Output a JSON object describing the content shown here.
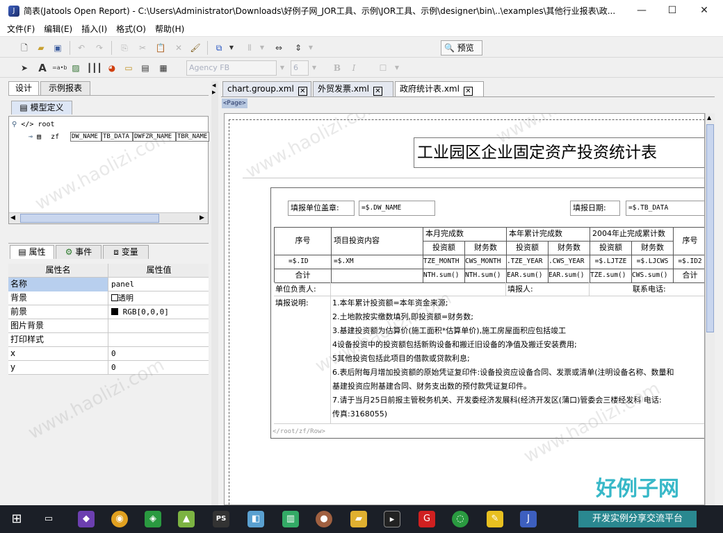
{
  "window": {
    "title": "简表(Jatools Open Report) - C:\\Users\\Administrator\\Downloads\\好例子网_JOR工具、示例\\JOR工具、示例\\designer\\bin\\..\\examples\\其他行业报表\\政...",
    "minimize": "—",
    "maximize": "☐",
    "close": "✕"
  },
  "menu": [
    "文件(F)",
    "编辑(E)",
    "插入(I)",
    "格式(O)",
    "帮助(H)"
  ],
  "toolbar": {
    "preview_label": "预览",
    "font_name": "Agency FB",
    "font_size": "6",
    "bold": "B",
    "italic": "I"
  },
  "left_tabs": [
    "设计",
    "示例报表"
  ],
  "model_tab": "模型定义",
  "tree": {
    "root": "root",
    "node": "zf",
    "fields": [
      "DW_NAME",
      "TB_DATA",
      "DWFZR_NAME",
      "TBR_NAME"
    ]
  },
  "prop_tabs": [
    "属性",
    "事件",
    "变量"
  ],
  "prop_headers": [
    "属性名",
    "属性值"
  ],
  "props": [
    {
      "name": "名称",
      "value": "panel"
    },
    {
      "name": "背景",
      "value": "透明"
    },
    {
      "name": "前景",
      "value": "RGB[0,0,0]"
    },
    {
      "name": "图片背景",
      "value": ""
    },
    {
      "name": "打印样式",
      "value": ""
    },
    {
      "name": "x",
      "value": "0"
    },
    {
      "name": "y",
      "value": "0"
    }
  ],
  "doc_tabs": [
    "chart.group.xml",
    "外贸发票.xml",
    "政府统计表.xml"
  ],
  "page_label": "<Page>",
  "report": {
    "title": "工业园区企业固定资产投资统计表",
    "unit_label": "填报单位盖章:",
    "unit_expr": "=$.DW_NAME",
    "date_label": "填报日期:",
    "date_expr": "=$.TB_DATA",
    "col_seq": "序号",
    "col_item": "项目投资内容",
    "group1": "本月完成数",
    "group2": "本年累计完成数",
    "group3": "2004年止完成累计数",
    "sub_invest": "投资额",
    "sub_finance": "财务数",
    "row_data": [
      "=$.ID",
      "=$.XM",
      "TZE_MONTH",
      "CWS_MONTH",
      ".TZE_YEAR",
      ".CWS_YEAR",
      "=$.LJTZE",
      "=$.LJCWS",
      "=$.ID2"
    ],
    "total_label": "合计",
    "row_sum": [
      "NTH.sum()",
      "NTH.sum()",
      "EAR.sum()",
      "EAR.sum()",
      "TZE.sum()",
      "CWS.sum()"
    ],
    "manager_label": "单位负责人:",
    "filler_label": "填报人:",
    "phone_label": "联系电话:",
    "notes_label": "填报说明:",
    "notes": [
      "1.本年累计投资额=本年资金来源;",
      "2.土地款按实缴数填列,即投资额=财务数;",
      "3.基建投资额为估算价(施工面积*估算单价),施工房屋面积应包括竣工",
      "4设备投资中的投资额包括新购设备和搬迁旧设备的净值及搬迁安装费用;",
      "5其他投资包括此项目的借款或贷款利息;",
      "6.表后附每月增加投资额的原始凭证复印件:设备投资应设备合同、发票或清单(注明设备名称、数量和",
      "基建投资应附基建合同、财务支出数的预付款凭证复印件。",
      "7.请于当月25日前报主管税务机关、开发委经济发展科(经济开发区(蒲口)管委会三楼经发科 电话:",
      "传真:3168055)"
    ],
    "row_path": "</root/zf/Row>"
  },
  "watermark": "www.haolizi.com",
  "brand": {
    "title": "好例子网",
    "subtitle": "开发实例分享交流平台"
  }
}
